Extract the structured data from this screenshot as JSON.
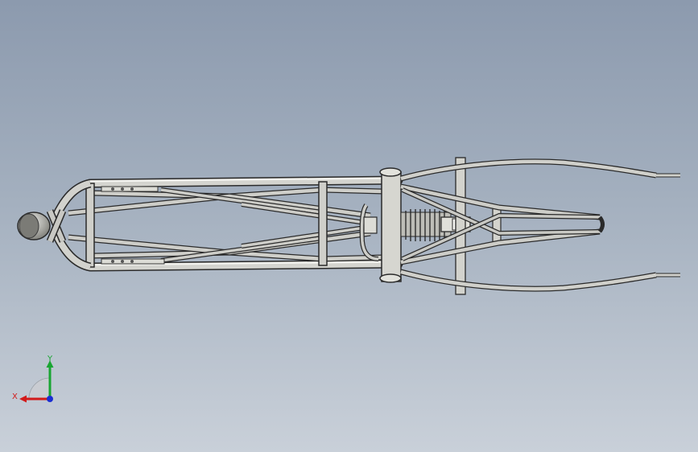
{
  "viewport": {
    "background_top": "#8c9aae",
    "background_bottom": "#c9d0d9"
  },
  "model": {
    "tube_color": "#c9c9c4",
    "tube_edge": "#2e2e2e"
  },
  "triad": {
    "x_label": "X",
    "y_label": "Y",
    "x_color": "#d21a1a",
    "y_color": "#19a532",
    "z_color": "#1a2ed2"
  }
}
